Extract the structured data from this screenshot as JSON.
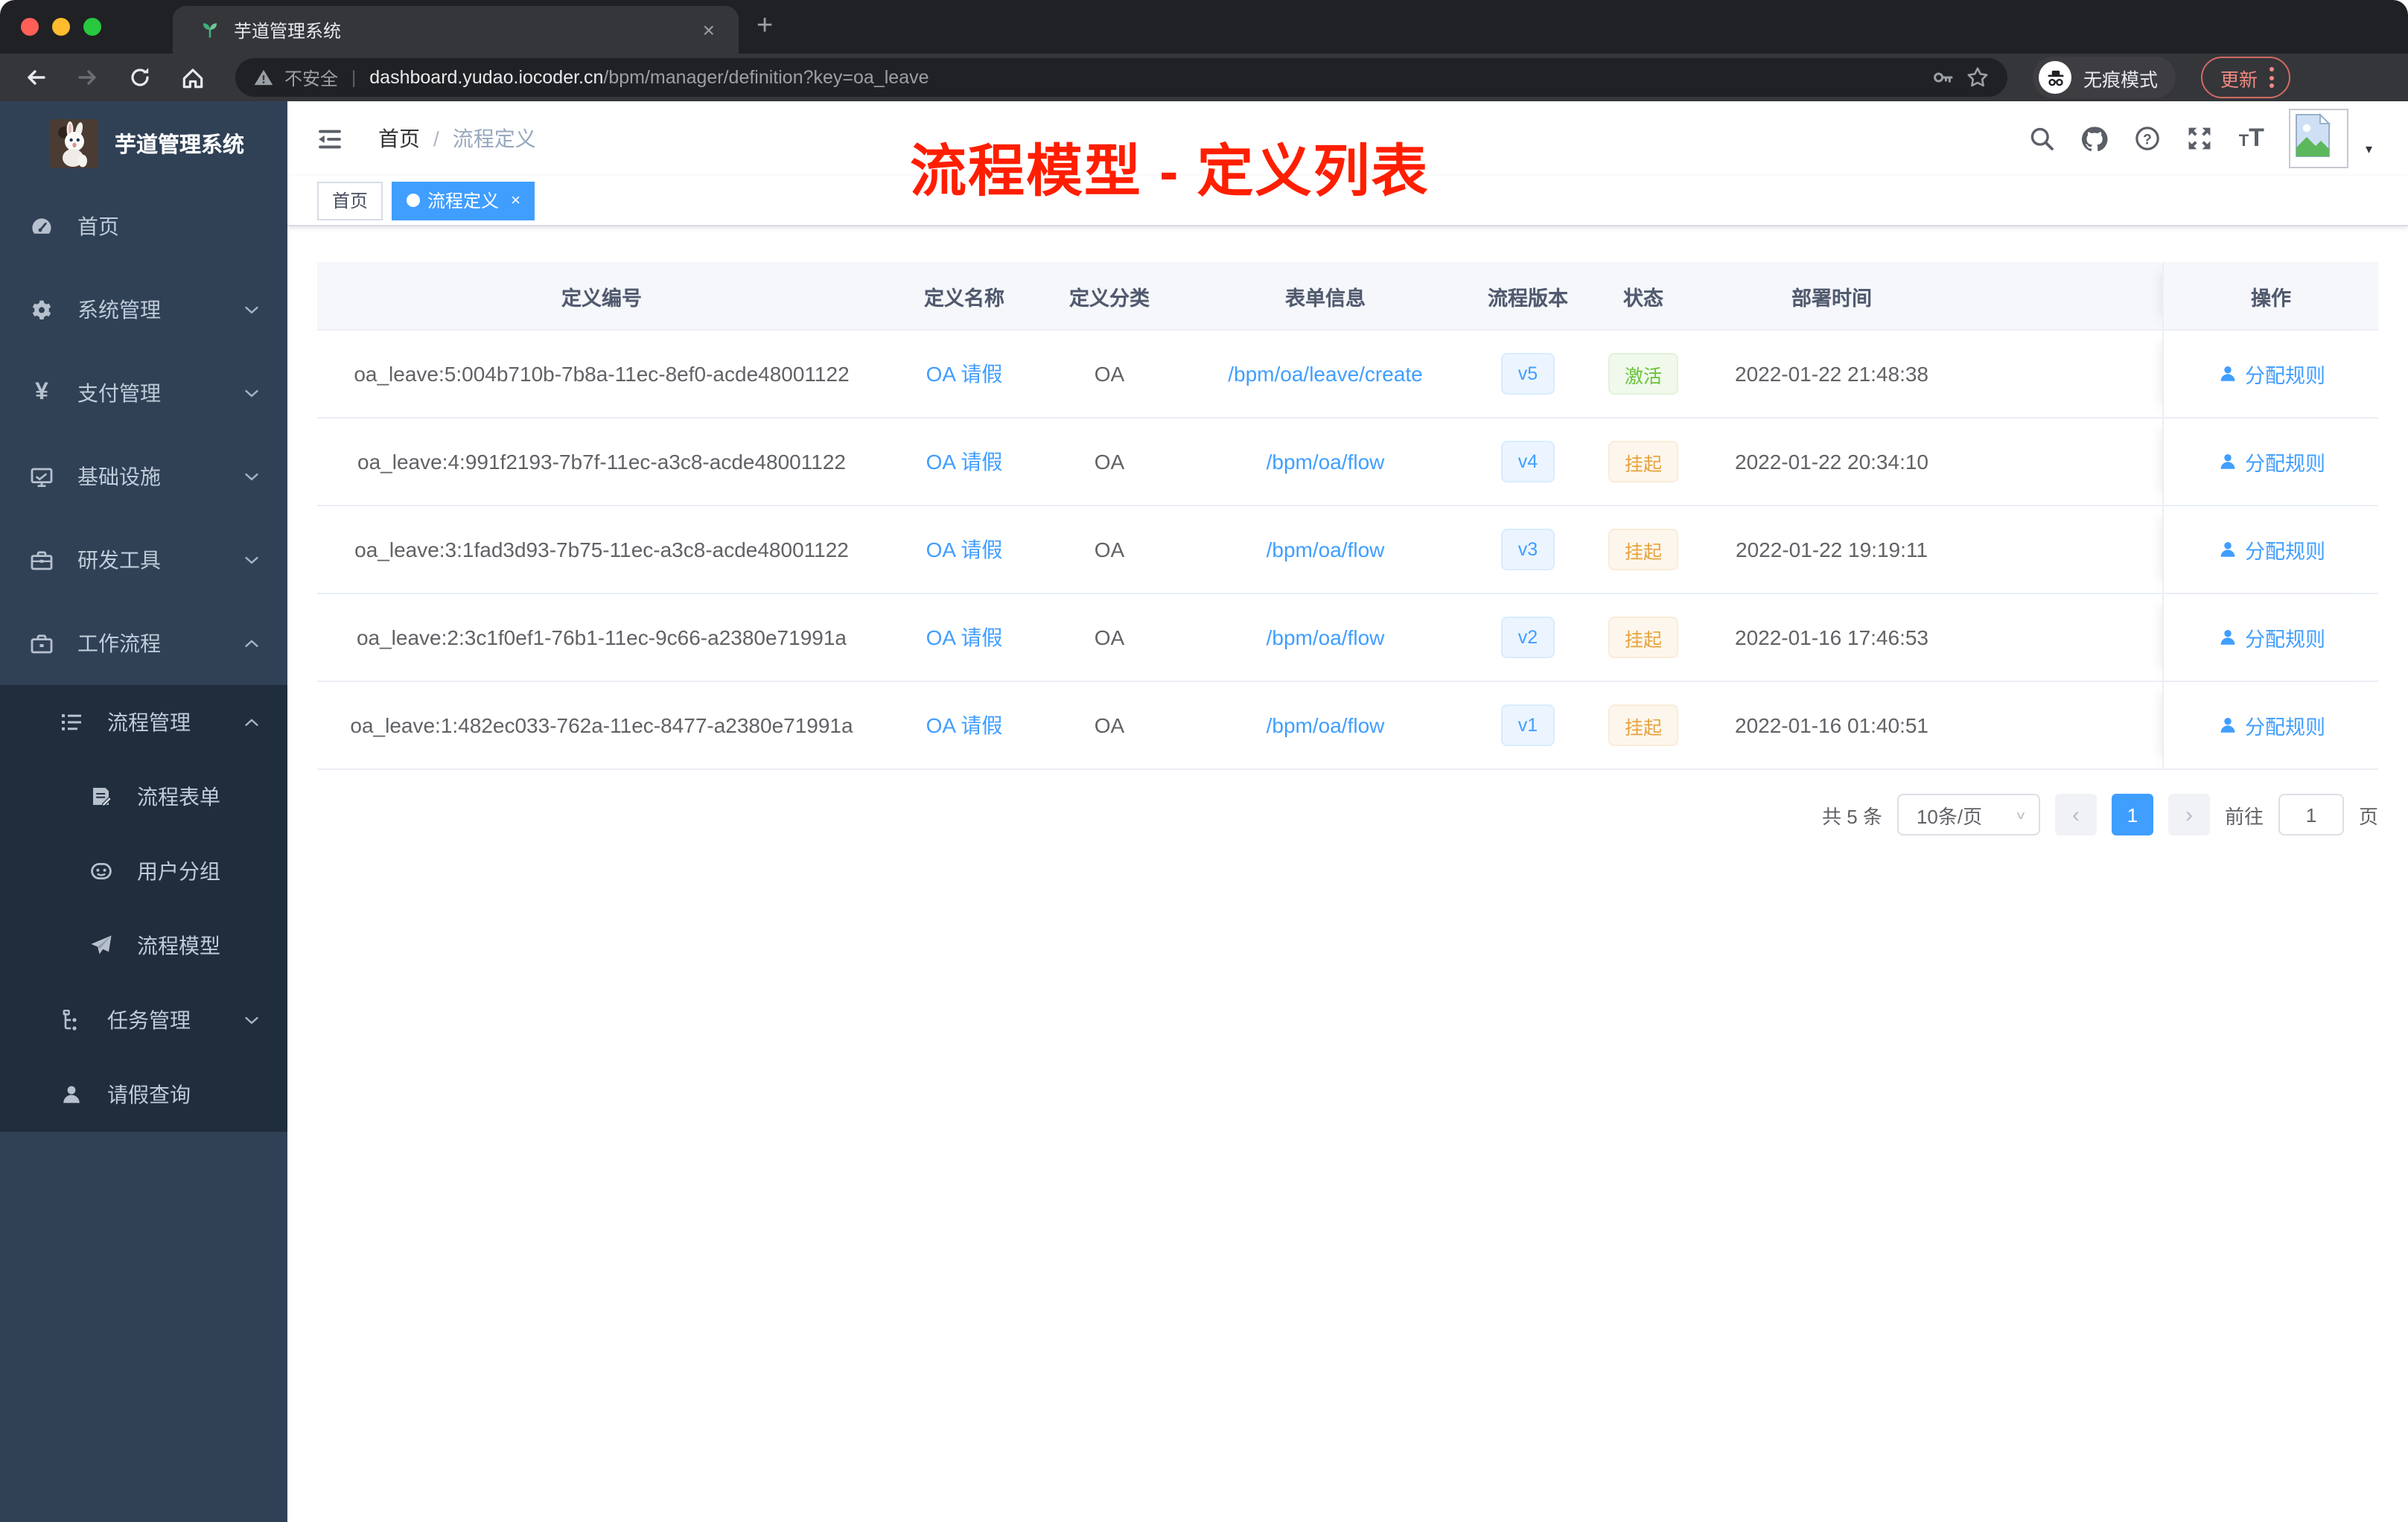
{
  "colors": {
    "accent": "#409eff",
    "success": "#67c23a",
    "warning": "#e6a23c",
    "annotation": "#ff1e00",
    "sidebar_bg": "#304156",
    "submenu_bg": "#1f2d3d"
  },
  "browser": {
    "tab_title": "芋道管理系统",
    "not_secure_label": "不安全",
    "url_host": "dashboard.yudao.iocoder.cn",
    "url_path": "/bpm/manager/definition?key=oa_leave",
    "incognito_label": "无痕模式",
    "update_label": "更新"
  },
  "glyphs": {
    "close": "×",
    "plus": "+",
    "caret": "▾",
    "pipe": "|",
    "slash": "/",
    "prev": "‹",
    "next": "›"
  },
  "sidebar": {
    "logo_title": "芋道管理系统",
    "items": [
      {
        "label": "首页"
      },
      {
        "label": "系统管理"
      },
      {
        "label": "支付管理"
      },
      {
        "label": "基础设施"
      },
      {
        "label": "研发工具"
      },
      {
        "label": "工作流程"
      },
      {
        "label": "流程管理"
      },
      {
        "label": "流程表单"
      },
      {
        "label": "用户分组"
      },
      {
        "label": "流程模型"
      },
      {
        "label": "任务管理"
      },
      {
        "label": "请假查询"
      }
    ]
  },
  "navbar": {
    "breadcrumb_home": "首页",
    "breadcrumb_current": "流程定义",
    "annotation": "流程模型 - 定义列表"
  },
  "tags": [
    {
      "label": "首页"
    },
    {
      "label": "流程定义"
    }
  ],
  "table": {
    "columns": [
      "定义编号",
      "定义名称",
      "定义分类",
      "表单信息",
      "流程版本",
      "状态",
      "部署时间",
      "操作"
    ],
    "action_label": "分配规则",
    "rows": [
      {
        "id": "oa_leave:5:004b710b-7b8a-11ec-8ef0-acde48001122",
        "name": "OA 请假",
        "category": "OA",
        "form": "/bpm/oa/leave/create",
        "version": "v5",
        "status": "激活",
        "time": "2022-01-22 21:48:38"
      },
      {
        "id": "oa_leave:4:991f2193-7b7f-11ec-a3c8-acde48001122",
        "name": "OA 请假",
        "category": "OA",
        "form": "/bpm/oa/flow",
        "version": "v4",
        "status": "挂起",
        "time": "2022-01-22 20:34:10"
      },
      {
        "id": "oa_leave:3:1fad3d93-7b75-11ec-a3c8-acde48001122",
        "name": "OA 请假",
        "category": "OA",
        "form": "/bpm/oa/flow",
        "version": "v3",
        "status": "挂起",
        "time": "2022-01-22 19:19:11"
      },
      {
        "id": "oa_leave:2:3c1f0ef1-76b1-11ec-9c66-a2380e71991a",
        "name": "OA 请假",
        "category": "OA",
        "form": "/bpm/oa/flow",
        "version": "v2",
        "status": "挂起",
        "time": "2022-01-16 17:46:53"
      },
      {
        "id": "oa_leave:1:482ec033-762a-11ec-8477-a2380e71991a",
        "name": "OA 请假",
        "category": "OA",
        "form": "/bpm/oa/flow",
        "version": "v1",
        "status": "挂起",
        "time": "2022-01-16 01:40:51"
      }
    ]
  },
  "pagination": {
    "total": "共 5 条",
    "page_size": "10条/页",
    "current_page": "1",
    "goto_label": "前往",
    "page_unit": "页"
  }
}
